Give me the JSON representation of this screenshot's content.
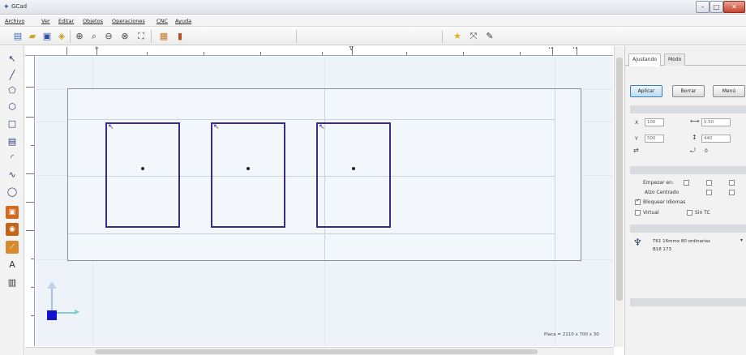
{
  "window": {
    "title": "GCad"
  },
  "menu": [
    "Archivo",
    "Ver",
    "Editar",
    "Objetos",
    "Operaciones",
    "CNC",
    "Ayuda"
  ],
  "toolbar": {
    "left_icons": [
      "new-file-icon",
      "open-folder-icon",
      "save-icon",
      "print-icon",
      "zoom-in-icon",
      "zoom-window-icon",
      "zoom-out-icon",
      "pan-icon",
      "layers-icon",
      "panel-icon"
    ],
    "right_icons": [
      "star-icon",
      "fit-icon",
      "pen-icon"
    ]
  },
  "tools": [
    "select-tool-icon",
    "line-tool-icon",
    "polyline-tool-icon",
    "polygon-tool-icon",
    "rectangle-tool-icon",
    "hatch-tool-icon",
    "arc-tool-icon",
    "curve-tool-icon",
    "circle-tool-icon",
    "pocket-tool-icon",
    "drill-tool-icon",
    "cut-tool-icon",
    "text-tool-icon",
    "dimension-tool-icon"
  ],
  "canvas": {
    "dimension_readout": "Placa = 2110 x 700 x 30"
  },
  "right_panel": {
    "tabs": [
      "Ajustando",
      "Modo"
    ],
    "buttons": {
      "apply": "Aplicar",
      "delete": "Borrar",
      "more": "Menú"
    },
    "fields": {
      "x_label": "X",
      "x_value": "100",
      "y_label": "Y",
      "y_value": "500",
      "w_value": "0.50",
      "h_value": "440",
      "angle_value": "0"
    },
    "options": {
      "empezar_en": "Empezar en:",
      "alzo_centrado": "Alzo Centrado",
      "bloquear_idiomas": "Bloquear Idiomas",
      "virtual": "Virtual",
      "sin_tc": "Sin TC"
    },
    "tool": {
      "line1": "T61 16mmx 80 ordinarias",
      "line2": "B18    173"
    }
  },
  "colors": {
    "pocket_outline": "#3b2b85",
    "canvas_bg": "#eef3fa",
    "origin_marker": "#1313c9"
  }
}
